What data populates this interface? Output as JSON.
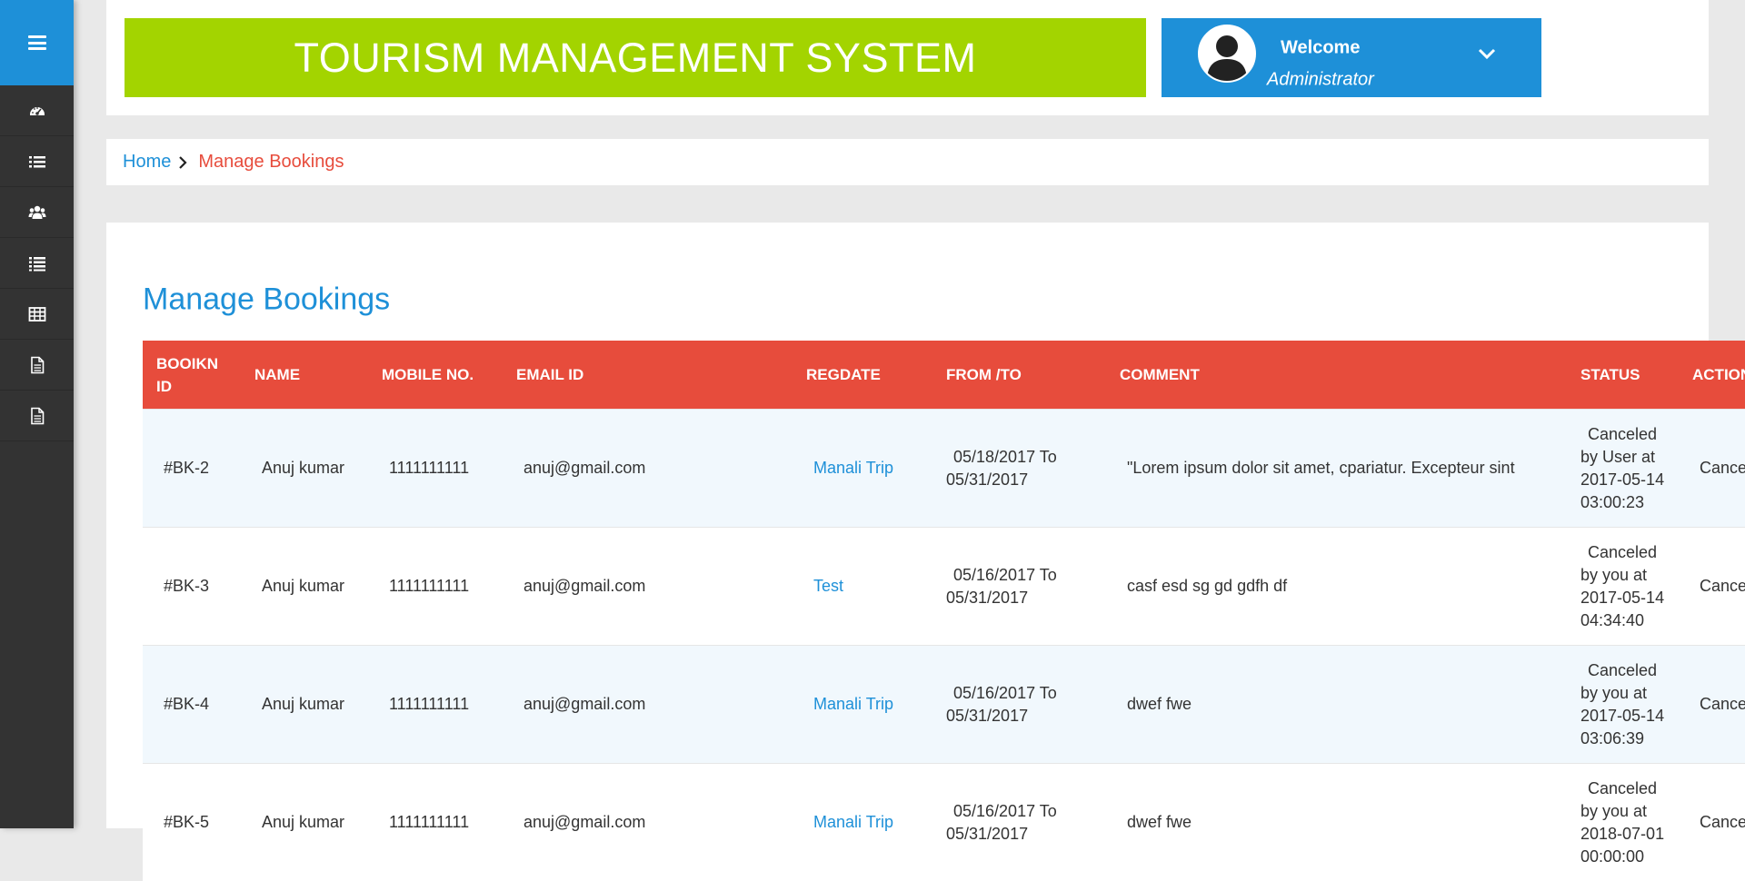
{
  "header": {
    "title": "TOURISM MANAGEMENT SYSTEM",
    "welcome": "Welcome",
    "role": "Administrator"
  },
  "sidebar": {
    "items": [
      {
        "icon": "dashboard-icon"
      },
      {
        "icon": "list-icon"
      },
      {
        "icon": "users-icon"
      },
      {
        "icon": "list-icon"
      },
      {
        "icon": "table-icon"
      },
      {
        "icon": "document-icon"
      },
      {
        "icon": "document-icon"
      }
    ]
  },
  "breadcrumb": {
    "home": "Home",
    "current": "Manage Bookings"
  },
  "main": {
    "title": "Manage Bookings"
  },
  "table": {
    "headers": {
      "booking_id_1": "BOOIKN",
      "booking_id_2": "ID",
      "name": "NAME",
      "mobile": "MOBILE NO.",
      "email": "EMAIL ID",
      "regdate": "REGDATE",
      "from_to": "FROM /TO",
      "comment": "COMMENT",
      "status": "STATUS",
      "action": "ACTION"
    },
    "rows": [
      {
        "id": "#BK-2",
        "name": "Anuj kumar",
        "mobile": "1111111111",
        "email": "anuj@gmail.com",
        "package": "Manali Trip",
        "from": "05/18/2017 To",
        "to": "05/31/2017",
        "comment": "\"Lorem ipsum dolor sit amet, cpariatur. Excepteur sint",
        "status": [
          "Canceled",
          "by User at",
          "2017-05-14",
          "03:00:23"
        ],
        "action": "Cancel"
      },
      {
        "id": "#BK-3",
        "name": "Anuj kumar",
        "mobile": "1111111111",
        "email": "anuj@gmail.com",
        "package": "Test",
        "from": "05/16/2017 To",
        "to": "05/31/2017",
        "comment": "casf esd sg gd gdfh df",
        "status": [
          "Canceled",
          "by you at",
          "2017-05-14",
          "04:34:40"
        ],
        "action": "Cancel"
      },
      {
        "id": "#BK-4",
        "name": "Anuj kumar",
        "mobile": "1111111111",
        "email": "anuj@gmail.com",
        "package": "Manali Trip",
        "from": "05/16/2017 To",
        "to": "05/31/2017",
        "comment": "dwef fwe",
        "status": [
          "Canceled",
          "by you at",
          "2017-05-14",
          "03:06:39"
        ],
        "action": "Cancel"
      },
      {
        "id": "#BK-5",
        "name": "Anuj kumar",
        "mobile": "1111111111",
        "email": "anuj@gmail.com",
        "package": "Manali Trip",
        "from": "05/16/2017 To",
        "to": "05/31/2017",
        "comment": "dwef fwe",
        "status": [
          "Canceled",
          "by you at",
          "2018-07-01",
          "00:00:00"
        ],
        "action": "Cancel"
      }
    ]
  },
  "colors": {
    "brand_blue": "#1e90d8",
    "title_green": "#a3d400",
    "table_header_red": "#e74c3c",
    "sidebar_dark": "#333333"
  }
}
